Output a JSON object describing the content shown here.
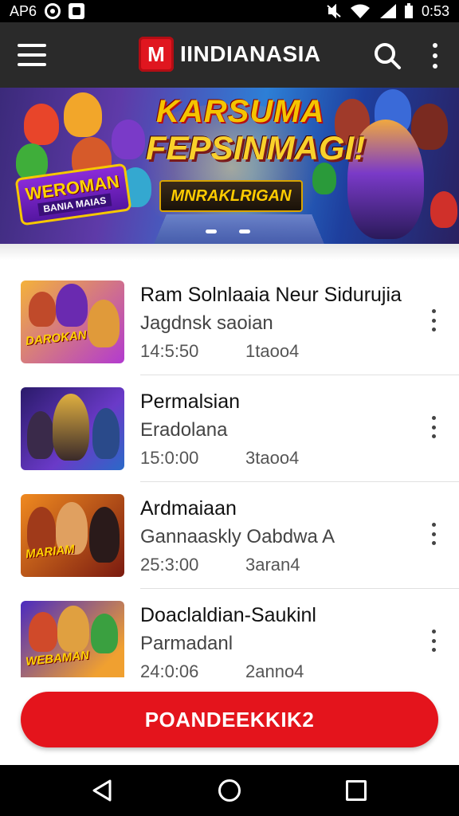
{
  "status_bar": {
    "carrier": "AP6",
    "time": "0:53",
    "icons": [
      "record-icon",
      "image-icon",
      "mute-icon",
      "wifi-icon",
      "signal-icon",
      "battery-icon"
    ]
  },
  "app_bar": {
    "title": "IINDIANASIA",
    "logo_letter": "M",
    "icons": [
      "menu-icon",
      "search-icon",
      "more-vert-icon"
    ]
  },
  "banner": {
    "title_line1": "KARSUMA",
    "title_line2": "FEPSINMAGI!",
    "subtitle": "MNRAKLRIGAN",
    "badge_line1": "WEROMAN",
    "badge_line2": "BANIA MAIAS",
    "pages": 2
  },
  "items": [
    {
      "title": "Ram Solnlaaia Neur Sidurujia",
      "subtitle": "Jagdnsk saoian",
      "time": "14:5:50",
      "count": "1taoo4",
      "thumb_text": "DAROKAN",
      "colors": [
        "#f0a020",
        "#9a3ad0"
      ]
    },
    {
      "title": "Permalsian",
      "subtitle": "Eradolana",
      "time": "15:0:00",
      "count": "3taoo4",
      "thumb_text": "",
      "colors": [
        "#3a1a6a",
        "#d4a020"
      ]
    },
    {
      "title": "Ardmaiaan",
      "subtitle": "Gannaaskly Oabdwa A",
      "time": "25:3:00",
      "count": "3aran4",
      "thumb_text": "MARIAM",
      "colors": [
        "#e06a10",
        "#6a1010"
      ]
    },
    {
      "title": "Doaclaldian-Saukinl",
      "subtitle": "Parmadanl",
      "time": "24:0:06",
      "count": "2anno4",
      "thumb_text": "WEBAMAN",
      "colors": [
        "#4a2ac0",
        "#f0a020"
      ]
    }
  ],
  "cta": {
    "label": "POANDEEKKIK2"
  },
  "nav": {
    "icons": [
      "back-icon",
      "home-icon",
      "recents-icon"
    ]
  },
  "colors": {
    "accent": "#e4141c",
    "appbar": "#2a2a2a"
  }
}
